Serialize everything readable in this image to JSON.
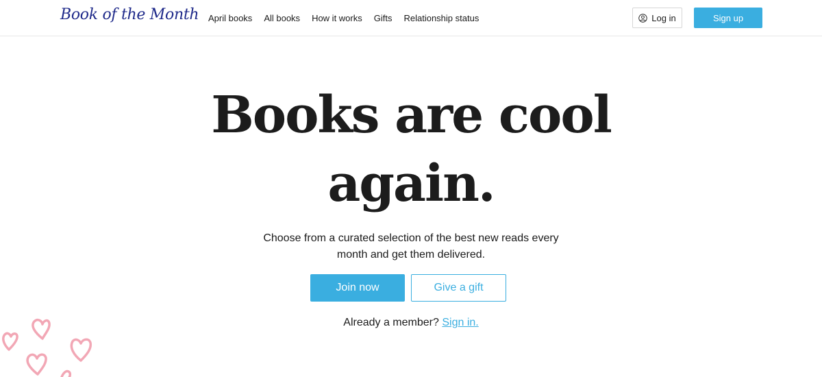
{
  "header": {
    "logo": "Book of the Month",
    "nav": [
      "April books",
      "All books",
      "How it works",
      "Gifts",
      "Relationship status"
    ],
    "login_label": "Log in",
    "signup_label": "Sign up"
  },
  "hero": {
    "title_line1": "Books are cool",
    "title_line2": "again.",
    "subtitle": "Choose from a curated selection of the best new reads every month and get them delivered.",
    "join_label": "Join now",
    "gift_label": "Give a gift",
    "member_prompt": "Already a member?",
    "signin_label": "Sign in."
  },
  "colors": {
    "accent": "#3aaee0",
    "logo": "#1f2a8a",
    "hearts": "#f2a7b5"
  },
  "icons": {
    "login": "user-circle-icon",
    "decoration": "hearts-doodle"
  }
}
